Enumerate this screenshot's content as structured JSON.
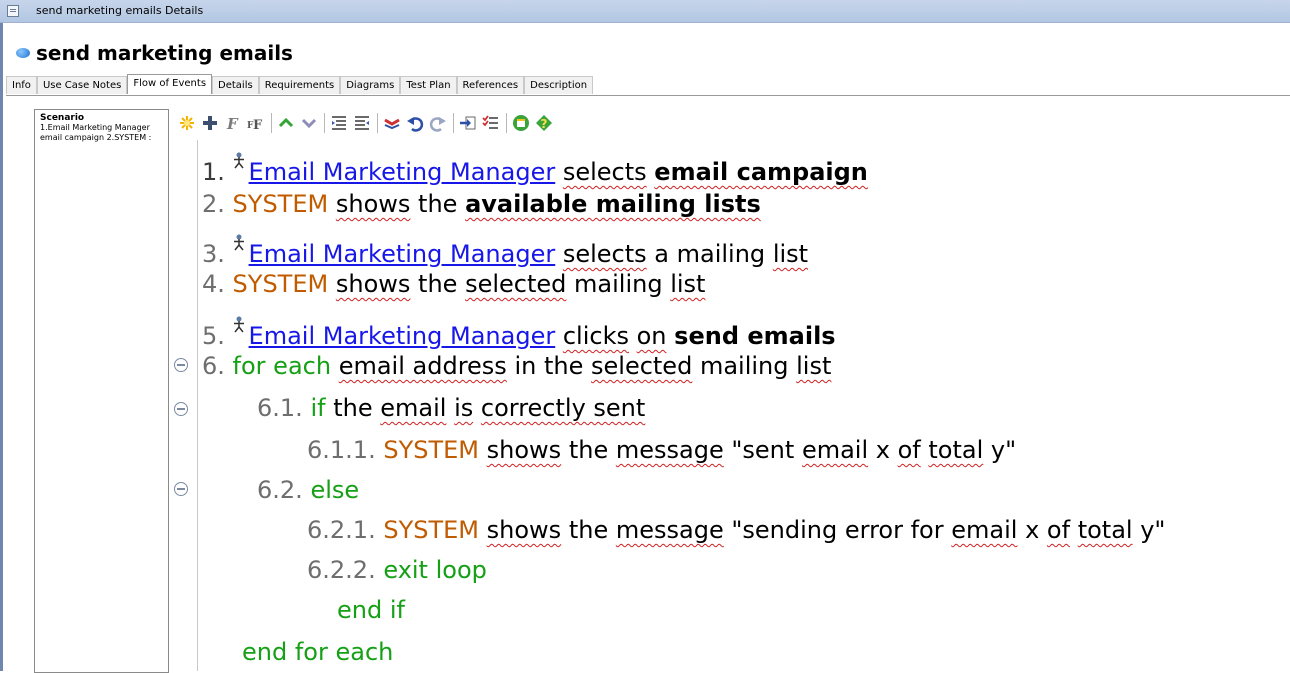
{
  "window": {
    "title": "send marketing emails Details"
  },
  "heading": "send marketing emails",
  "tabs": [
    "Info",
    "Use Case Notes",
    "Flow of Events",
    "Details",
    "Requirements",
    "Diagrams",
    "Test Plan",
    "References",
    "Description"
  ],
  "active_tab": "Flow of Events",
  "scenario": {
    "title": "Scenario",
    "line1": "1.Email Marketing Manager",
    "line2": "email campaign 2.SYSTEM :"
  },
  "toolbar": {
    "icons": [
      "new-scenario-icon",
      "add-step-icon",
      "format-icon",
      "format-all-icon",
      "move-up-icon",
      "move-down-icon",
      "outdent-icon",
      "indent-icon",
      "link-icon",
      "undo-icon",
      "redo-icon",
      "import-icon",
      "checklist-icon",
      "preview-icon",
      "help-icon"
    ]
  },
  "colors": {
    "system": "#c15b00",
    "keyword": "#16a016",
    "actor_link": "#1717e8",
    "number": "#6e6e6e"
  },
  "steps": {
    "s1": {
      "num": "1.",
      "actor": "Email Marketing Manager",
      "w1": "selects",
      "obj": "email campaign"
    },
    "s2": {
      "num": "2.",
      "sys": "SYSTEM",
      "w1": "shows",
      "w2": "the",
      "obj": "available mailing lists"
    },
    "s3": {
      "num": "3.",
      "actor": "Email Marketing Manager",
      "w1": "selects",
      "rest": "a mailing",
      "w2": "list"
    },
    "s4": {
      "num": "4.",
      "sys": "SYSTEM",
      "w1": "shows",
      "w2": "the",
      "w3": "selected",
      "rest": "mailing",
      "w4": "list"
    },
    "s5": {
      "num": "5.",
      "actor": "Email Marketing Manager",
      "w1": "clicks",
      "w2": "on",
      "obj": "send emails"
    },
    "s6": {
      "num": "6.",
      "kw": "for each",
      "w1": "email address",
      "w2": "in the",
      "w3": "selected",
      "rest": "mailing",
      "w4": "list"
    },
    "s61": {
      "num": "6.1.",
      "kw": "if",
      "w1": "the",
      "w2": "email",
      "w3": "is",
      "w4": "correctly sent"
    },
    "s611": {
      "num": "6.1.1.",
      "sys": "SYSTEM",
      "w1": "shows",
      "w2": "the",
      "w3": "message",
      "q1": "\"sent",
      "w4": "email",
      "x": "x",
      "w5": "of",
      "w6": "total",
      "y": "y\""
    },
    "s62": {
      "num": "6.2.",
      "kw": "else"
    },
    "s621": {
      "num": "6.2.1.",
      "sys": "SYSTEM",
      "w1": "shows",
      "w2": "the",
      "w3": "message",
      "q1": "\"sending error for",
      "w4": "email",
      "x": "x",
      "w5": "of",
      "w6": "total",
      "y": "y\""
    },
    "s622": {
      "num": "6.2.2.",
      "kw": "exit loop"
    },
    "endif": "end if",
    "endfor": "end for each"
  }
}
